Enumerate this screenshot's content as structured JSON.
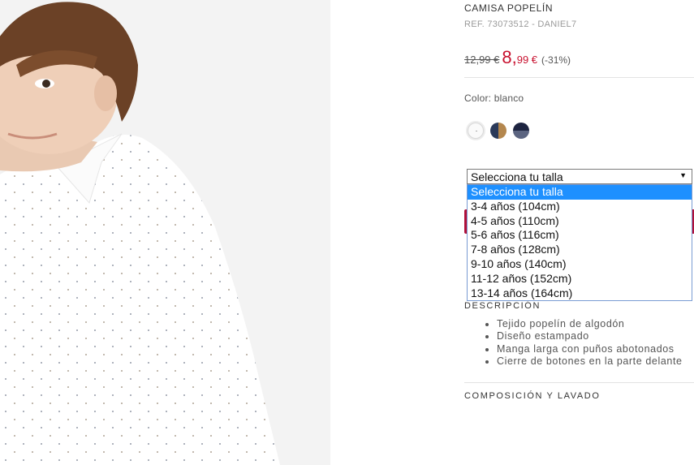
{
  "product": {
    "title": "CAMISA POPELÍN",
    "ref": "REF. 73073512 - DANIEL7",
    "old_price": "12,99 €",
    "new_price_int": "8,",
    "new_price_dec": "99 €",
    "discount": "(-31%)",
    "color_label": "Color: blanco",
    "swatches": [
      {
        "name": "blanco",
        "color": "#fafafa"
      },
      {
        "name": "marino-camel",
        "colors": [
          "#2b3a5a",
          "#b4874e"
        ]
      },
      {
        "name": "marino",
        "colors": [
          "#1d2440",
          "#5b6480"
        ]
      }
    ]
  },
  "size_select": {
    "selected": "Selecciona tu talla",
    "options": [
      "Selecciona tu talla",
      "3-4 años (104cm)",
      "4-5 años (110cm)",
      "5-6 años (116cm)",
      "7-8 años (128cm)",
      "9-10 años (140cm)",
      "11-12 años (152cm)",
      "13-14 años (164cm)"
    ]
  },
  "description": {
    "heading": "DESCRIPCIÓN",
    "items": [
      "Tejido popelín de algodón",
      "Diseño estampado",
      "Manga larga con puños abotonados",
      "Cierre de botones en la parte delante"
    ]
  },
  "composition": {
    "heading": "COMPOSICIÓN Y LAVADO"
  },
  "colors": {
    "price_red": "#c8102e",
    "cart_button": "#b0103a",
    "dropdown_highlight": "#1e90ff"
  }
}
